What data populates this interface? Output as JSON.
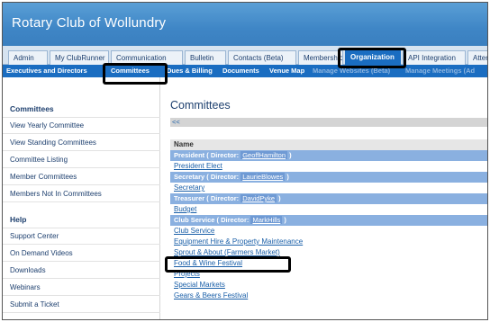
{
  "header": {
    "title": "Rotary Club of Wollundry"
  },
  "tabs": [
    {
      "label": "Admin"
    },
    {
      "label": "My ClubRunner"
    },
    {
      "label": "Communication"
    },
    {
      "label": "Bulletin"
    },
    {
      "label": "Contacts (Beta)"
    },
    {
      "label": "Membership"
    },
    {
      "label": "Organization"
    },
    {
      "label": "API Integration"
    },
    {
      "label": "Attendance"
    }
  ],
  "subnav": [
    {
      "label": "Executives and Directors"
    },
    {
      "label": "Committees"
    },
    {
      "label": "Dues & Billing"
    },
    {
      "label": "Documents"
    },
    {
      "label": "Venue Map"
    },
    {
      "label": "Manage Websites (Beta)"
    },
    {
      "label": "Manage Meetings (Ad"
    }
  ],
  "sidebar": {
    "committees_heading": "Committees",
    "committee_links": [
      {
        "label": "View Yearly Committee"
      },
      {
        "label": "View Standing Committees"
      },
      {
        "label": "Committee Listing"
      },
      {
        "label": "Member Committees"
      },
      {
        "label": "Members Not In Committees"
      }
    ],
    "help_heading": "Help",
    "help_links": [
      {
        "label": "Support Center"
      },
      {
        "label": "On Demand Videos"
      },
      {
        "label": "Downloads"
      },
      {
        "label": "Webinars"
      },
      {
        "label": "Submit a Ticket"
      }
    ]
  },
  "main": {
    "title": "Committees",
    "back": "<<",
    "column_header": "Name",
    "rows": [
      {
        "type": "group",
        "name": "President",
        "director_label": "Director:",
        "director": "GeoffHamilton"
      },
      {
        "type": "item",
        "name": "President Elect"
      },
      {
        "type": "group",
        "name": "Secretary",
        "director_label": "Director:",
        "director": "LaurieBlowes"
      },
      {
        "type": "item",
        "name": "Secretary"
      },
      {
        "type": "group",
        "name": "Treasurer",
        "director_label": "Director:",
        "director": "DavidPyke"
      },
      {
        "type": "item",
        "name": "Budget"
      },
      {
        "type": "group",
        "name": "Club Service",
        "director_label": "Director:",
        "director": "MarkHills"
      },
      {
        "type": "item",
        "name": "Club Service"
      },
      {
        "type": "item",
        "name": "Equipment Hire & Property Maintenance"
      },
      {
        "type": "item",
        "name": "Sprout & About (Farmers Market)"
      },
      {
        "type": "item",
        "name": "Food & Wine Festival"
      },
      {
        "type": "item",
        "name": "Projects"
      },
      {
        "type": "item",
        "name": "Special Markets"
      },
      {
        "type": "item",
        "name": "Gears & Beers Festival"
      }
    ]
  }
}
